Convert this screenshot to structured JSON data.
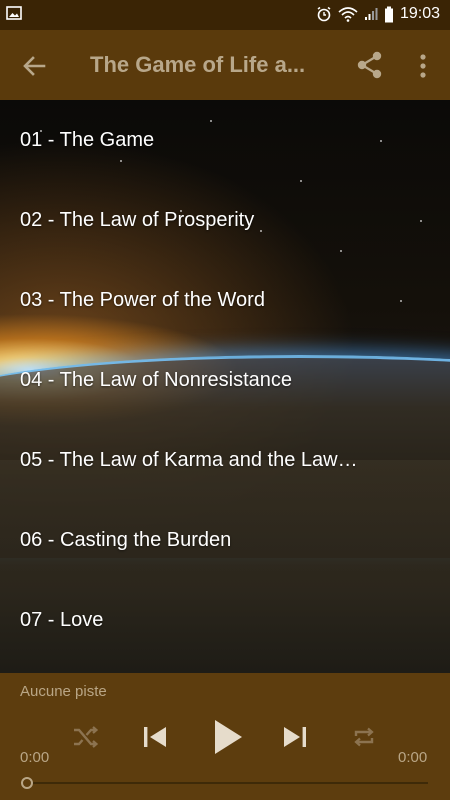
{
  "status_bar": {
    "time": "19:03",
    "icons": [
      "image-icon",
      "alarm-icon",
      "wifi-icon",
      "signal-icon",
      "battery-icon"
    ]
  },
  "app_bar": {
    "title": "The Game of Life a...",
    "actions": [
      "back-icon",
      "share-icon",
      "more-icon"
    ]
  },
  "tracks": [
    {
      "label": "01 - The Game"
    },
    {
      "label": "02 - The Law of Prosperity"
    },
    {
      "label": "03 - The Power of the Word"
    },
    {
      "label": "04 - The Law of Nonresistance"
    },
    {
      "label": "05 - The Law of Karma and the Law…"
    },
    {
      "label": "06 - Casting the Burden"
    },
    {
      "label": "07 - Love"
    }
  ],
  "player": {
    "now_playing": "Aucune piste",
    "elapsed": "0:00",
    "duration": "0:00",
    "progress": 0,
    "controls": [
      "shuffle-icon",
      "previous-icon",
      "play-icon",
      "next-icon",
      "repeat-icon"
    ]
  },
  "colors": {
    "status_bar": "#3a2405",
    "app_bar": "#5a3a0c",
    "player_bg": "#5d3d0e",
    "muted_text": "#b9a686",
    "control_active": "#e6dccb",
    "control_disabled": "#8c7350"
  }
}
